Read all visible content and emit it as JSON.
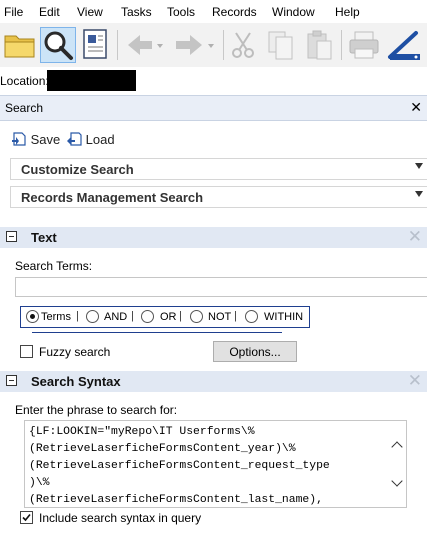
{
  "menu": [
    "File",
    "Edit",
    "View",
    "Tasks",
    "Tools",
    "Records",
    "Window",
    "Help"
  ],
  "toolbar": {
    "icons": [
      "folder-icon",
      "search-icon",
      "document-icon",
      "back-icon",
      "forward-icon",
      "cut-icon",
      "copy-icon",
      "paste-icon",
      "print-icon",
      "scanner-icon"
    ]
  },
  "location": {
    "label": "Location:"
  },
  "search_panel": {
    "title": "Search",
    "close": "✕",
    "save_label": "Save",
    "load_label": "Load",
    "customize_search": "Customize Search",
    "records_management_search": "Records Management Search"
  },
  "text_section": {
    "title": "Text",
    "terms_label": "Search Terms:",
    "terms_value": "",
    "operators": [
      "Terms",
      "AND",
      "OR",
      "NOT",
      "WITHIN"
    ],
    "selected_operator": "Terms",
    "fuzzy_label": "Fuzzy search",
    "fuzzy_checked": false,
    "options_button": "Options..."
  },
  "syntax_section": {
    "title": "Search Syntax",
    "phrase_label": "Enter the phrase to search for:",
    "syntax_text": "{LF:LOOKIN=\"myRepo\\IT Userforms\\%\n(RetrieveLaserficheFormsContent_year)\\%\n(RetrieveLaserficheFormsContent_request_type\n)\\%\n(RetrieveLaserficheFormsContent_last_name),",
    "include_label": "Include search syntax in query",
    "include_checked": true
  },
  "colors": {
    "section_header": "#e1e8f3",
    "operator_border": "#1f3f8f",
    "toolbar_bg": "#f2f2f2"
  }
}
